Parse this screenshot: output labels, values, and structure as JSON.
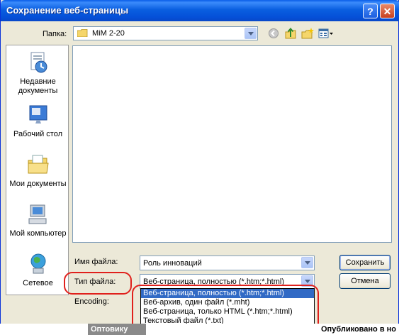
{
  "window": {
    "title": "Сохранение веб-страницы",
    "help_glyph": "?",
    "close_glyph": "✕"
  },
  "location": {
    "label": "Папка:",
    "value": "MiM 2-20"
  },
  "places": [
    {
      "label": "Недавние документы",
      "icon": "recent-documents-icon"
    },
    {
      "label": "Рабочий стол",
      "icon": "desktop-icon"
    },
    {
      "label": "Мои документы",
      "icon": "my-documents-icon"
    },
    {
      "label": "Мой компьютер",
      "icon": "my-computer-icon"
    },
    {
      "label": "Сетевое",
      "icon": "network-icon"
    }
  ],
  "filename": {
    "label": "Имя файла:",
    "value": "Роль инноваций"
  },
  "filetype": {
    "label": "Тип файла:",
    "value": "Веб-страница, полностью (*.htm;*.html)",
    "options": [
      "Веб-страница, полностью (*.htm;*.html)",
      "Веб-архив, один файл  (*.mht)",
      "Веб-страница, только HTML (*.htm;*.html)",
      "Текстовый файл (*.txt)"
    ],
    "selected_index": 0
  },
  "encoding": {
    "label": "Encoding:"
  },
  "buttons": {
    "save": "Сохранить",
    "cancel": "Отмена"
  },
  "background": {
    "tab_label": "Оптовику",
    "text": "Опубликовано в но"
  },
  "colors": {
    "titlebar": "#0a5fe0",
    "selection": "#316ac5",
    "highlight_ring": "#e0201c"
  }
}
